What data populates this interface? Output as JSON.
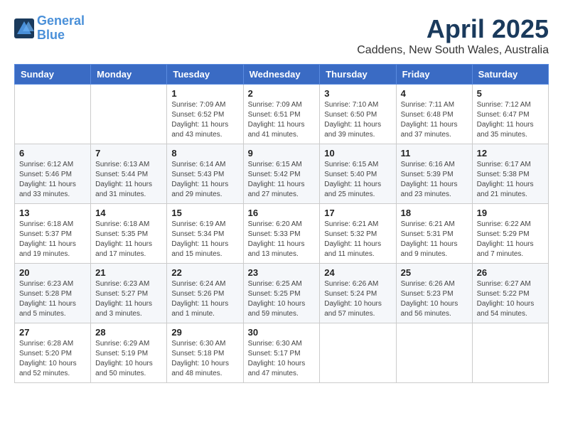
{
  "header": {
    "logo_line1": "General",
    "logo_line2": "Blue",
    "month_title": "April 2025",
    "subtitle": "Caddens, New South Wales, Australia"
  },
  "days_of_week": [
    "Sunday",
    "Monday",
    "Tuesday",
    "Wednesday",
    "Thursday",
    "Friday",
    "Saturday"
  ],
  "weeks": [
    {
      "row_class": "row-odd",
      "days": [
        {
          "num": "",
          "info": "",
          "empty": true
        },
        {
          "num": "",
          "info": "",
          "empty": true
        },
        {
          "num": "1",
          "info": "Sunrise: 7:09 AM\nSunset: 6:52 PM\nDaylight: 11 hours and 43 minutes.",
          "empty": false
        },
        {
          "num": "2",
          "info": "Sunrise: 7:09 AM\nSunset: 6:51 PM\nDaylight: 11 hours and 41 minutes.",
          "empty": false
        },
        {
          "num": "3",
          "info": "Sunrise: 7:10 AM\nSunset: 6:50 PM\nDaylight: 11 hours and 39 minutes.",
          "empty": false
        },
        {
          "num": "4",
          "info": "Sunrise: 7:11 AM\nSunset: 6:48 PM\nDaylight: 11 hours and 37 minutes.",
          "empty": false
        },
        {
          "num": "5",
          "info": "Sunrise: 7:12 AM\nSunset: 6:47 PM\nDaylight: 11 hours and 35 minutes.",
          "empty": false
        }
      ]
    },
    {
      "row_class": "row-even",
      "days": [
        {
          "num": "6",
          "info": "Sunrise: 6:12 AM\nSunset: 5:46 PM\nDaylight: 11 hours and 33 minutes.",
          "empty": false
        },
        {
          "num": "7",
          "info": "Sunrise: 6:13 AM\nSunset: 5:44 PM\nDaylight: 11 hours and 31 minutes.",
          "empty": false
        },
        {
          "num": "8",
          "info": "Sunrise: 6:14 AM\nSunset: 5:43 PM\nDaylight: 11 hours and 29 minutes.",
          "empty": false
        },
        {
          "num": "9",
          "info": "Sunrise: 6:15 AM\nSunset: 5:42 PM\nDaylight: 11 hours and 27 minutes.",
          "empty": false
        },
        {
          "num": "10",
          "info": "Sunrise: 6:15 AM\nSunset: 5:40 PM\nDaylight: 11 hours and 25 minutes.",
          "empty": false
        },
        {
          "num": "11",
          "info": "Sunrise: 6:16 AM\nSunset: 5:39 PM\nDaylight: 11 hours and 23 minutes.",
          "empty": false
        },
        {
          "num": "12",
          "info": "Sunrise: 6:17 AM\nSunset: 5:38 PM\nDaylight: 11 hours and 21 minutes.",
          "empty": false
        }
      ]
    },
    {
      "row_class": "row-odd",
      "days": [
        {
          "num": "13",
          "info": "Sunrise: 6:18 AM\nSunset: 5:37 PM\nDaylight: 11 hours and 19 minutes.",
          "empty": false
        },
        {
          "num": "14",
          "info": "Sunrise: 6:18 AM\nSunset: 5:35 PM\nDaylight: 11 hours and 17 minutes.",
          "empty": false
        },
        {
          "num": "15",
          "info": "Sunrise: 6:19 AM\nSunset: 5:34 PM\nDaylight: 11 hours and 15 minutes.",
          "empty": false
        },
        {
          "num": "16",
          "info": "Sunrise: 6:20 AM\nSunset: 5:33 PM\nDaylight: 11 hours and 13 minutes.",
          "empty": false
        },
        {
          "num": "17",
          "info": "Sunrise: 6:21 AM\nSunset: 5:32 PM\nDaylight: 11 hours and 11 minutes.",
          "empty": false
        },
        {
          "num": "18",
          "info": "Sunrise: 6:21 AM\nSunset: 5:31 PM\nDaylight: 11 hours and 9 minutes.",
          "empty": false
        },
        {
          "num": "19",
          "info": "Sunrise: 6:22 AM\nSunset: 5:29 PM\nDaylight: 11 hours and 7 minutes.",
          "empty": false
        }
      ]
    },
    {
      "row_class": "row-even",
      "days": [
        {
          "num": "20",
          "info": "Sunrise: 6:23 AM\nSunset: 5:28 PM\nDaylight: 11 hours and 5 minutes.",
          "empty": false
        },
        {
          "num": "21",
          "info": "Sunrise: 6:23 AM\nSunset: 5:27 PM\nDaylight: 11 hours and 3 minutes.",
          "empty": false
        },
        {
          "num": "22",
          "info": "Sunrise: 6:24 AM\nSunset: 5:26 PM\nDaylight: 11 hours and 1 minute.",
          "empty": false
        },
        {
          "num": "23",
          "info": "Sunrise: 6:25 AM\nSunset: 5:25 PM\nDaylight: 10 hours and 59 minutes.",
          "empty": false
        },
        {
          "num": "24",
          "info": "Sunrise: 6:26 AM\nSunset: 5:24 PM\nDaylight: 10 hours and 57 minutes.",
          "empty": false
        },
        {
          "num": "25",
          "info": "Sunrise: 6:26 AM\nSunset: 5:23 PM\nDaylight: 10 hours and 56 minutes.",
          "empty": false
        },
        {
          "num": "26",
          "info": "Sunrise: 6:27 AM\nSunset: 5:22 PM\nDaylight: 10 hours and 54 minutes.",
          "empty": false
        }
      ]
    },
    {
      "row_class": "row-odd",
      "days": [
        {
          "num": "27",
          "info": "Sunrise: 6:28 AM\nSunset: 5:20 PM\nDaylight: 10 hours and 52 minutes.",
          "empty": false
        },
        {
          "num": "28",
          "info": "Sunrise: 6:29 AM\nSunset: 5:19 PM\nDaylight: 10 hours and 50 minutes.",
          "empty": false
        },
        {
          "num": "29",
          "info": "Sunrise: 6:30 AM\nSunset: 5:18 PM\nDaylight: 10 hours and 48 minutes.",
          "empty": false
        },
        {
          "num": "30",
          "info": "Sunrise: 6:30 AM\nSunset: 5:17 PM\nDaylight: 10 hours and 47 minutes.",
          "empty": false
        },
        {
          "num": "",
          "info": "",
          "empty": true
        },
        {
          "num": "",
          "info": "",
          "empty": true
        },
        {
          "num": "",
          "info": "",
          "empty": true
        }
      ]
    }
  ]
}
